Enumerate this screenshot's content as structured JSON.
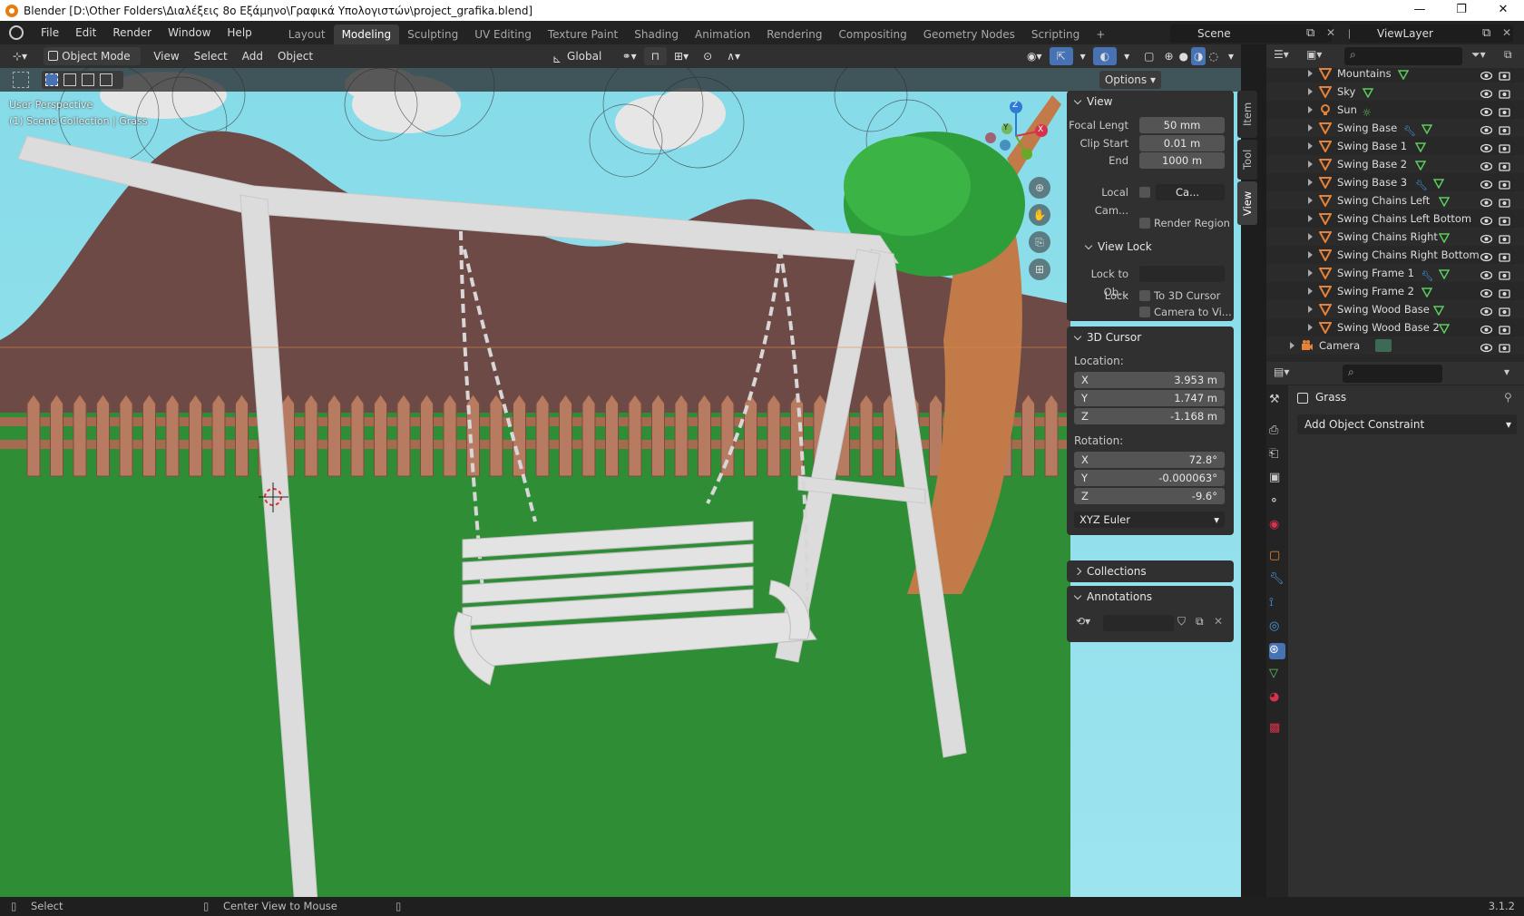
{
  "window": {
    "title": "Blender [D:\\Other Folders\\Διαλέξεις 8ο Εξάμηνο\\Γραφικά Υπολογιστών\\project_grafika.blend]",
    "controls": [
      "—",
      "❐",
      "✕"
    ]
  },
  "menu": [
    "File",
    "Edit",
    "Render",
    "Window",
    "Help"
  ],
  "workspaces": [
    {
      "label": "Layout",
      "active": false
    },
    {
      "label": "Modeling",
      "active": true
    },
    {
      "label": "Sculpting",
      "active": false
    },
    {
      "label": "UV Editing",
      "active": false
    },
    {
      "label": "Texture Paint",
      "active": false
    },
    {
      "label": "Shading",
      "active": false
    },
    {
      "label": "Animation",
      "active": false
    },
    {
      "label": "Rendering",
      "active": false
    },
    {
      "label": "Compositing",
      "active": false
    },
    {
      "label": "Geometry Nodes",
      "active": false
    },
    {
      "label": "Scripting",
      "active": false
    }
  ],
  "add_workspace": "+",
  "scene": "Scene",
  "view_layer": "ViewLayer",
  "viewport_header": {
    "mode": "Object Mode",
    "menus": [
      "View",
      "Select",
      "Add",
      "Object"
    ],
    "orientation": "Global"
  },
  "viewport": {
    "perspective": "User Perspective",
    "collection": "(1) Scene Collection | Grass",
    "options": "Options"
  },
  "gizmo": {
    "x": "X",
    "y": "Y",
    "z": "Z"
  },
  "npanel": {
    "tabs": [
      "Item",
      "Tool",
      "View"
    ],
    "view": {
      "title": "View",
      "focal_label": "Focal Lengt",
      "focal_value": "50 mm",
      "clip_start_label": "Clip Start",
      "clip_start_value": "0.01 m",
      "end_label": "End",
      "end_value": "1000 m",
      "local_cam_label": "Local Cam...",
      "local_cam_value": "Ca...",
      "render_region": "Render Region"
    },
    "view_lock": {
      "title": "View Lock",
      "lock_to_label": "Lock to Ob...",
      "lock_label": "Lock",
      "to_cursor": "To 3D Cursor",
      "camera_to_view": "Camera to Vi..."
    },
    "cursor": {
      "title": "3D Cursor",
      "location_label": "Location:",
      "loc": [
        {
          "axis": "X",
          "value": "3.953 m"
        },
        {
          "axis": "Y",
          "value": "1.747 m"
        },
        {
          "axis": "Z",
          "value": "-1.168 m"
        }
      ],
      "rotation_label": "Rotation:",
      "rot": [
        {
          "axis": "X",
          "value": "72.8°"
        },
        {
          "axis": "Y",
          "value": "-0.000063°"
        },
        {
          "axis": "Z",
          "value": "-9.6°"
        }
      ],
      "mode": "XYZ Euler"
    },
    "collections": "Collections",
    "annotations": "Annotations"
  },
  "outliner": [
    {
      "name": "Mountains",
      "type": "mesh",
      "icon_color": "#e5823a",
      "extra": "mesh"
    },
    {
      "name": "Sky",
      "type": "mesh",
      "icon_color": "#e5823a",
      "extra": "mesh"
    },
    {
      "name": "Sun",
      "type": "light",
      "icon_color": "#e5823a",
      "extra": "light"
    },
    {
      "name": "Swing Base",
      "type": "mesh",
      "icon_color": "#e5823a",
      "extra": "modmesh"
    },
    {
      "name": "Swing Base 1",
      "type": "mesh",
      "icon_color": "#e5823a",
      "extra": "mesh"
    },
    {
      "name": "Swing Base 2",
      "type": "mesh",
      "icon_color": "#e5823a",
      "extra": "mesh"
    },
    {
      "name": "Swing Base 3",
      "type": "mesh",
      "icon_color": "#e5823a",
      "extra": "modmesh"
    },
    {
      "name": "Swing Chains Left",
      "type": "mesh",
      "icon_color": "#e5823a",
      "extra": "mesh"
    },
    {
      "name": "Swing Chains Left Bottom",
      "type": "mesh",
      "icon_color": "#e5823a",
      "extra": "none"
    },
    {
      "name": "Swing Chains Right",
      "type": "mesh",
      "icon_color": "#e5823a",
      "extra": "mesh"
    },
    {
      "name": "Swing Chains Right Bottom",
      "type": "mesh",
      "icon_color": "#e5823a",
      "extra": "none"
    },
    {
      "name": "Swing Frame 1",
      "type": "mesh",
      "icon_color": "#e5823a",
      "extra": "modmesh"
    },
    {
      "name": "Swing Frame 2",
      "type": "mesh",
      "icon_color": "#e5823a",
      "extra": "mesh"
    },
    {
      "name": "Swing Wood Base",
      "type": "mesh",
      "icon_color": "#e5823a",
      "extra": "mesh"
    },
    {
      "name": "Swing Wood Base 2",
      "type": "mesh",
      "icon_color": "#e5823a",
      "extra": "mesh"
    },
    {
      "name": "Camera",
      "type": "camera",
      "icon_color": "#e5823a",
      "extra": "camera"
    }
  ],
  "properties": {
    "object_name": "Grass",
    "add_constraint": "Add Object Constraint"
  },
  "status": {
    "select": "Select",
    "center": "Center View to Mouse",
    "version": "3.1.2"
  }
}
